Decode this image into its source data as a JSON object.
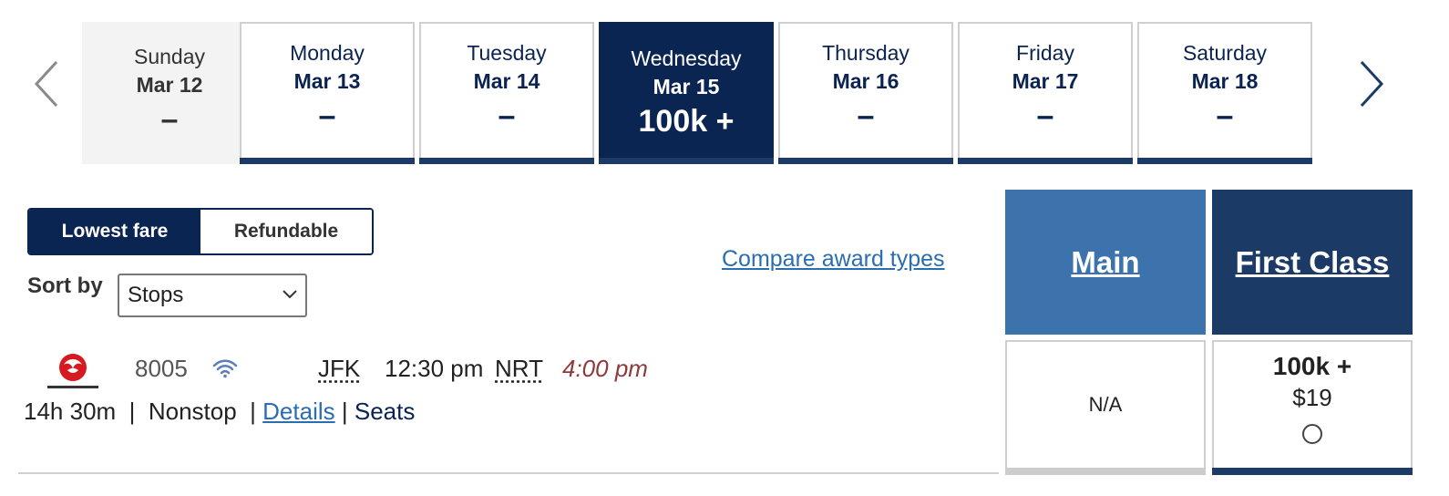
{
  "date_strip": {
    "prev_icon": "chevron-left-icon",
    "next_icon": "chevron-right-icon",
    "days": [
      {
        "day": "Sunday",
        "date": "Mar 12",
        "price": "–",
        "state": "past"
      },
      {
        "day": "Monday",
        "date": "Mar 13",
        "price": "–",
        "state": "available"
      },
      {
        "day": "Tuesday",
        "date": "Mar 14",
        "price": "–",
        "state": "available"
      },
      {
        "day": "Wednesday",
        "date": "Mar 15",
        "price": "100k +",
        "state": "selected"
      },
      {
        "day": "Thursday",
        "date": "Mar 16",
        "price": "–",
        "state": "available"
      },
      {
        "day": "Friday",
        "date": "Mar 17",
        "price": "–",
        "state": "available"
      },
      {
        "day": "Saturday",
        "date": "Mar 18",
        "price": "–",
        "state": "available"
      }
    ]
  },
  "fare_toggle": {
    "options": [
      "Lowest fare",
      "Refundable"
    ],
    "selected": "Lowest fare"
  },
  "sort": {
    "label": "Sort by",
    "value": "Stops"
  },
  "compare_link": "Compare award types",
  "cabins": {
    "main": "Main",
    "first": "First Class"
  },
  "flight": {
    "airline_logo": "japan-airlines-logo",
    "flight_number": "8005",
    "wifi_icon": "wifi-icon",
    "depart_airport": "JFK",
    "depart_time": "12:30 pm",
    "arrive_airport": "NRT",
    "arrive_time": "4:00 pm",
    "duration": "14h 30m",
    "sep1": "|",
    "stops": "Nonstop",
    "sep2": "|",
    "details_link": "Details",
    "sep3": "|",
    "seats_link": "Seats",
    "main_fare": "N/A",
    "first_fare_miles": "100k +",
    "first_fare_tax": "$19"
  },
  "colors": {
    "navy": "#0b2552",
    "main_blue": "#3d73ad",
    "first_blue": "#1b3a66",
    "link_blue": "#2a6db0",
    "arrival_red": "#8e3a3a"
  }
}
